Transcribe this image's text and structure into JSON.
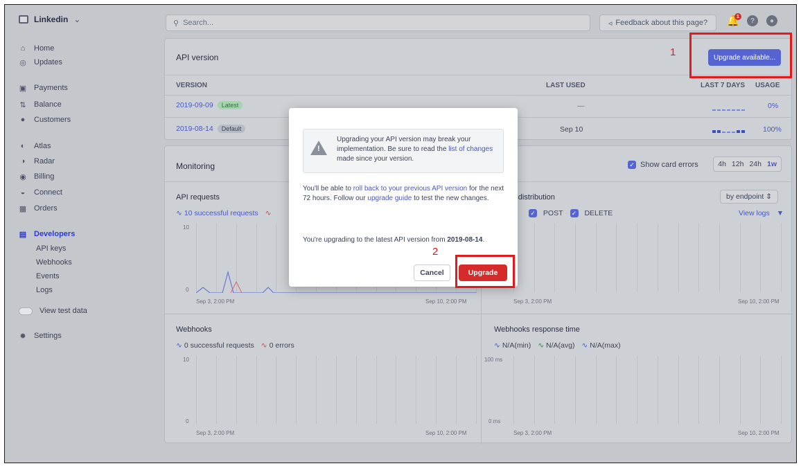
{
  "sidebar": {
    "account": "Linkedin",
    "items": [
      {
        "label": "Home",
        "icon": "home-icon"
      },
      {
        "label": "Updates",
        "icon": "updates-icon"
      },
      {
        "label": "Payments",
        "icon": "payments-icon"
      },
      {
        "label": "Balance",
        "icon": "balance-icon"
      },
      {
        "label": "Customers",
        "icon": "customers-icon"
      },
      {
        "label": "Atlas",
        "icon": "atlas-icon"
      },
      {
        "label": "Radar",
        "icon": "radar-icon"
      },
      {
        "label": "Billing",
        "icon": "billing-icon"
      },
      {
        "label": "Connect",
        "icon": "connect-icon"
      },
      {
        "label": "Orders",
        "icon": "orders-icon"
      },
      {
        "label": "Developers",
        "icon": "developers-icon"
      }
    ],
    "dev_items": [
      "API keys",
      "Webhooks",
      "Events",
      "Logs"
    ],
    "test_data": "View test data",
    "settings": "Settings"
  },
  "topbar": {
    "search_placeholder": "Search...",
    "feedback": "Feedback about this page?",
    "notifications": "1"
  },
  "api_version": {
    "title": "API version",
    "upgrade_button": "Upgrade available...",
    "headers": {
      "version": "VERSION",
      "last_used": "LAST USED",
      "last7": "LAST 7 DAYS",
      "usage": "USAGE"
    },
    "rows": [
      {
        "version": "2019-09-09",
        "tag": "Latest",
        "last_used": "—",
        "usage": "0%"
      },
      {
        "version": "2019-08-14",
        "tag": "Default",
        "last_used": "Sep 10",
        "usage": "100%"
      }
    ]
  },
  "monitoring": {
    "title": "Monitoring",
    "show_card_errors": "Show card errors",
    "ranges": [
      "4h",
      "12h",
      "24h",
      "1w"
    ],
    "api_requests": {
      "title": "API requests",
      "legend_success": "10 successful requests",
      "y_max": "10",
      "y_min": "0",
      "x_start": "Sep 3, 2:00 PM",
      "x_end": "Sep 10, 2:00 PM"
    },
    "error_distribution": {
      "title": "r distribution",
      "select": "by endpoint",
      "post": "POST",
      "delete": "DELETE",
      "view_logs": "View logs",
      "x_start": "Sep 3, 2:00 PM",
      "x_end": "Sep 10, 2:00 PM"
    },
    "webhooks": {
      "title": "Webhooks",
      "legend_success": "0 successful requests",
      "legend_errors": "0 errors",
      "y_max": "10",
      "y_min": "0",
      "x_start": "Sep 3, 2:00 PM",
      "x_end": "Sep 10, 2:00 PM"
    },
    "webhooks_response": {
      "title": "Webhooks response time",
      "min": "N/A(min)",
      "avg": "N/A(avg)",
      "max": "N/A(max)",
      "y_max": "100 ms",
      "y_min": "0 ms",
      "x_start": "Sep 3, 2:00 PM",
      "x_end": "Sep 10, 2:00 PM"
    }
  },
  "modal": {
    "warning_pre": "Upgrading your API version may break your implementation. Be sure to read the ",
    "warning_link": "list of changes",
    "warning_post": " made since your version.",
    "rollback_pre": "You'll be able to ",
    "rollback_link": "roll back to your previous API version",
    "rollback_mid": " for the next 72 hours. Follow our ",
    "guide_link": "upgrade guide",
    "rollback_post": " to test the new changes.",
    "upgrading_pre": "You're upgrading to the latest API version from ",
    "upgrading_version": "2019-08-14",
    "upgrading_post": ".",
    "cancel": "Cancel",
    "upgrade": "Upgrade"
  },
  "annotations": {
    "one": "1",
    "two": "2"
  }
}
